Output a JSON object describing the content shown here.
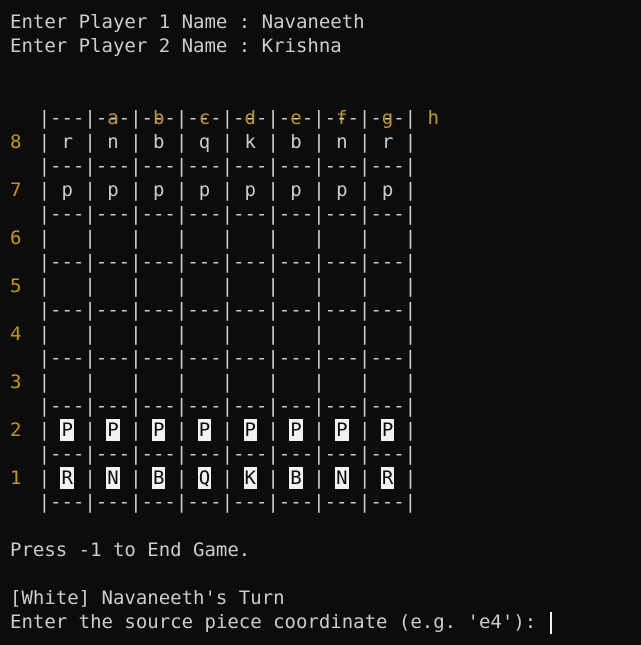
{
  "prompts": {
    "p1_label": "Enter Player 1 Name : ",
    "p1_value": "Navaneeth",
    "p2_label": "Enter Player 2 Name : ",
    "p2_value": "Krishna"
  },
  "board": {
    "files": [
      "a",
      "b",
      "c",
      "d",
      "e",
      "f",
      "g",
      "h"
    ],
    "separator": "|---|---|---|---|---|---|---|---|",
    "ranks": [
      {
        "label": "8",
        "squares": [
          {
            "p": "r",
            "color": "black"
          },
          {
            "p": "n",
            "color": "black"
          },
          {
            "p": "b",
            "color": "black"
          },
          {
            "p": "q",
            "color": "black"
          },
          {
            "p": "k",
            "color": "black"
          },
          {
            "p": "b",
            "color": "black"
          },
          {
            "p": "n",
            "color": "black"
          },
          {
            "p": "r",
            "color": "black"
          }
        ]
      },
      {
        "label": "7",
        "squares": [
          {
            "p": "p",
            "color": "black"
          },
          {
            "p": "p",
            "color": "black"
          },
          {
            "p": "p",
            "color": "black"
          },
          {
            "p": "p",
            "color": "black"
          },
          {
            "p": "p",
            "color": "black"
          },
          {
            "p": "p",
            "color": "black"
          },
          {
            "p": "p",
            "color": "black"
          },
          {
            "p": "p",
            "color": "black"
          }
        ]
      },
      {
        "label": "6",
        "squares": [
          {
            "p": "",
            "color": ""
          },
          {
            "p": "",
            "color": ""
          },
          {
            "p": "",
            "color": ""
          },
          {
            "p": "",
            "color": ""
          },
          {
            "p": "",
            "color": ""
          },
          {
            "p": "",
            "color": ""
          },
          {
            "p": "",
            "color": ""
          },
          {
            "p": "",
            "color": ""
          }
        ]
      },
      {
        "label": "5",
        "squares": [
          {
            "p": "",
            "color": ""
          },
          {
            "p": "",
            "color": ""
          },
          {
            "p": "",
            "color": ""
          },
          {
            "p": "",
            "color": ""
          },
          {
            "p": "",
            "color": ""
          },
          {
            "p": "",
            "color": ""
          },
          {
            "p": "",
            "color": ""
          },
          {
            "p": "",
            "color": ""
          }
        ]
      },
      {
        "label": "4",
        "squares": [
          {
            "p": "",
            "color": ""
          },
          {
            "p": "",
            "color": ""
          },
          {
            "p": "",
            "color": ""
          },
          {
            "p": "",
            "color": ""
          },
          {
            "p": "",
            "color": ""
          },
          {
            "p": "",
            "color": ""
          },
          {
            "p": "",
            "color": ""
          },
          {
            "p": "",
            "color": ""
          }
        ]
      },
      {
        "label": "3",
        "squares": [
          {
            "p": "",
            "color": ""
          },
          {
            "p": "",
            "color": ""
          },
          {
            "p": "",
            "color": ""
          },
          {
            "p": "",
            "color": ""
          },
          {
            "p": "",
            "color": ""
          },
          {
            "p": "",
            "color": ""
          },
          {
            "p": "",
            "color": ""
          },
          {
            "p": "",
            "color": ""
          }
        ]
      },
      {
        "label": "2",
        "squares": [
          {
            "p": "P",
            "color": "white"
          },
          {
            "p": "P",
            "color": "white"
          },
          {
            "p": "P",
            "color": "white"
          },
          {
            "p": "P",
            "color": "white"
          },
          {
            "p": "P",
            "color": "white"
          },
          {
            "p": "P",
            "color": "white"
          },
          {
            "p": "P",
            "color": "white"
          },
          {
            "p": "P",
            "color": "white"
          }
        ]
      },
      {
        "label": "1",
        "squares": [
          {
            "p": "R",
            "color": "white"
          },
          {
            "p": "N",
            "color": "white"
          },
          {
            "p": "B",
            "color": "white"
          },
          {
            "p": "Q",
            "color": "white"
          },
          {
            "p": "K",
            "color": "white"
          },
          {
            "p": "B",
            "color": "white"
          },
          {
            "p": "N",
            "color": "white"
          },
          {
            "p": "R",
            "color": "white"
          }
        ]
      }
    ]
  },
  "footer": {
    "end_hint": "Press -1 to End Game.",
    "turn": "[White] Navaneeth's Turn",
    "input_prompt": "Enter the source piece coordinate (e.g. 'e4'): ",
    "input_value": ""
  },
  "colors": {
    "background": "#0c0c0c",
    "text": "#cccccc",
    "label_gold": "#c19c00",
    "white_piece_bg": "#f2f2f2"
  }
}
